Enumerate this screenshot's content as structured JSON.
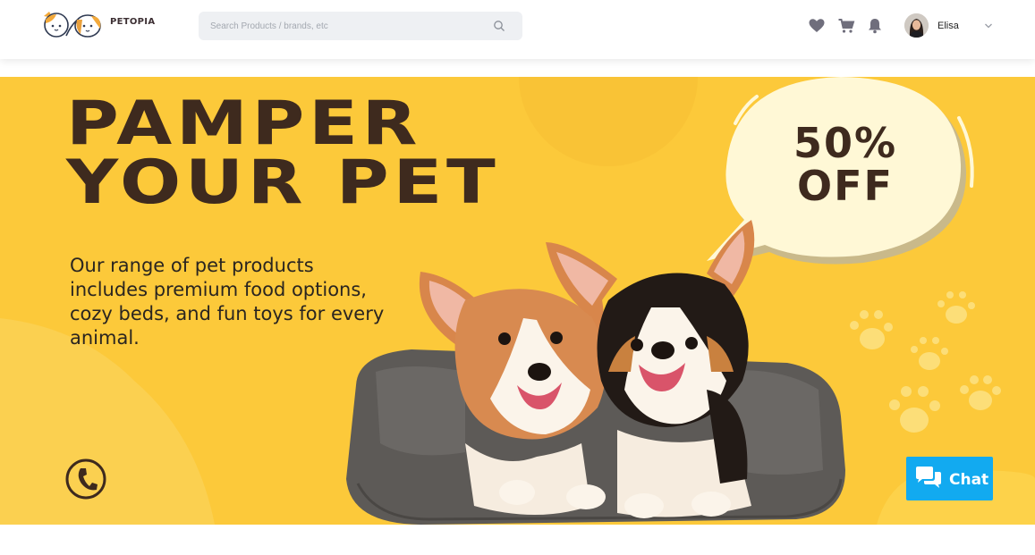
{
  "header": {
    "brand": "PETOPIA",
    "search_placeholder": "Search Products / brands, etc",
    "user_name": "Elisa"
  },
  "banner": {
    "headline_line1": "PAMPER",
    "headline_line2": "YOUR PET",
    "description": "Our range of pet products includes premium food options, cozy beds, and fun toys for every animal.",
    "offer_line1": "50%",
    "offer_line2": "OFF"
  },
  "chat": {
    "label": "Chat"
  },
  "colors": {
    "banner_bg": "#fcc93a",
    "headline": "#3e2a1e",
    "chat_bg": "#12aaf0",
    "bubble": "#fff8d6"
  }
}
